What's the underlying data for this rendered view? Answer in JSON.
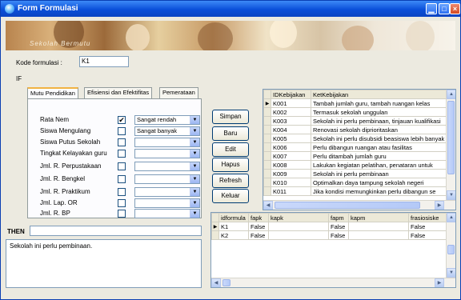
{
  "window": {
    "title": "Form Formulasi",
    "minimize_icon": "minimize-icon",
    "maximize_icon": "maximize-icon",
    "close_icon": "close-icon"
  },
  "banner": {
    "text": "Sekolah Bermutu"
  },
  "form": {
    "kode_label": "Kode formulasi :",
    "kode_value": "K1",
    "if_label": "IF",
    "then_label": "THEN",
    "then_value": "",
    "result_text": "Sekolah ini perlu pembinaan."
  },
  "tabs": [
    "Mutu Pendidikan",
    "Efisiensi dan Efektifitas",
    "Pemerataan"
  ],
  "criteria": [
    {
      "label": "Rata Nem",
      "checked": true,
      "value": "Sangat rendah"
    },
    {
      "label": "Siswa Mengulang",
      "checked": false,
      "value": "Sangat banyak"
    },
    {
      "label": "Siswa Putus Sekolah",
      "checked": false,
      "value": ""
    },
    {
      "label": "Tingkat Kelayakan guru",
      "checked": false,
      "value": ""
    },
    {
      "label": "Jml. R. Perpustakaan",
      "checked": false,
      "value": ""
    },
    {
      "label": "Jml. R. Bengkel",
      "checked": false,
      "value": ""
    },
    {
      "label": "Jml. R. Praktikum",
      "checked": false,
      "value": ""
    },
    {
      "label": "Jml. Lap. OR",
      "checked": false,
      "value": ""
    },
    {
      "label": "Jml. R. BP",
      "checked": false,
      "value": ""
    }
  ],
  "buttons": {
    "simpan": "Simpan",
    "baru": "Baru",
    "edit": "Edit",
    "hapus": "Hapus",
    "refresh": "Refresh",
    "keluar": "Keluar"
  },
  "kebijakan_grid": {
    "columns": [
      "IDKebijakan",
      "KetKebijakan"
    ],
    "rows": [
      [
        "K001",
        "Tambah jumlah guru, tambah ruangan kelas"
      ],
      [
        "K002",
        "Termasuk sekolah unggulan"
      ],
      [
        "K003",
        "Sekolah ini perlu pembinaan, tinjauan kualifikasi"
      ],
      [
        "K004",
        "Renovasi sekolah diprioritaskan"
      ],
      [
        "K005",
        "Sekolah ini perlu disubsidi beasiswa lebih banyak"
      ],
      [
        "K006",
        "Perlu dibangun ruangan atau fasilitas"
      ],
      [
        "K007",
        "Perlu ditambah jumlah guru"
      ],
      [
        "K008",
        "Lakukan kegiatan pelatihan, penataran untuk"
      ],
      [
        "K009",
        "Sekolah ini perlu pembinaan"
      ],
      [
        "K010",
        "Optimalkan daya tampung sekolah negeri"
      ],
      [
        "K011",
        "Jika kondisi memungkinkan perlu dibangun se"
      ]
    ]
  },
  "formula_grid": {
    "columns": [
      "idformula",
      "fapk",
      "kapk",
      "fapm",
      "kapm",
      "frasiosiske"
    ],
    "rows": [
      [
        "K1",
        "False",
        "",
        "False",
        "",
        "False"
      ],
      [
        "K2",
        "False",
        "",
        "False",
        "",
        "False"
      ]
    ]
  },
  "row_pointer": "▶",
  "colors": {
    "titlebar": "#0a4fd9",
    "face": "#eceae0",
    "active_tab": "#f1b343"
  }
}
